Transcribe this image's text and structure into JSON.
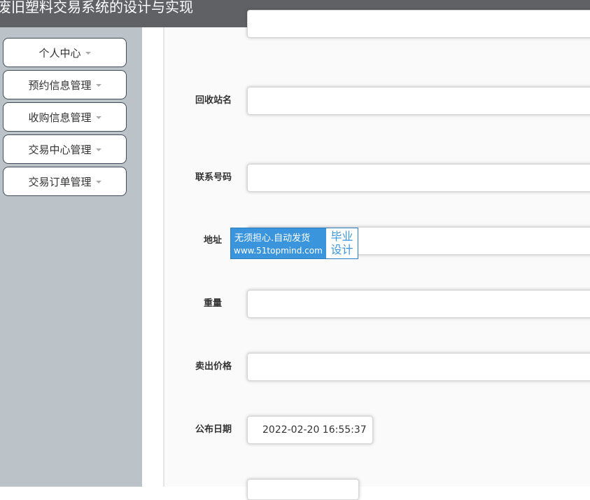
{
  "header": {
    "title": "废旧塑料交易系统的设计与实现"
  },
  "sidebar": {
    "items": [
      {
        "label": "个人中心"
      },
      {
        "label": "预约信息管理"
      },
      {
        "label": "收购信息管理"
      },
      {
        "label": "交易中心管理"
      },
      {
        "label": "交易订单管理"
      }
    ]
  },
  "form": {
    "fields": [
      {
        "label": "回收站名",
        "value": ""
      },
      {
        "label": "联系号码",
        "value": ""
      },
      {
        "label": "地址",
        "value": ""
      },
      {
        "label": "重量",
        "value": ""
      },
      {
        "label": "卖出价格",
        "value": ""
      },
      {
        "label": "公布日期",
        "value": "2022-02-20 16:55:37"
      }
    ]
  },
  "watermark": {
    "line1": "无须担心.自动发货",
    "line2": "www.51topmind.com",
    "badge1": "毕业",
    "badge2": "设计"
  },
  "colors": {
    "header_bg": "#5f6165",
    "sidebar_bg": "#bbc3c8",
    "watermark_bg": "#3a95dc"
  }
}
